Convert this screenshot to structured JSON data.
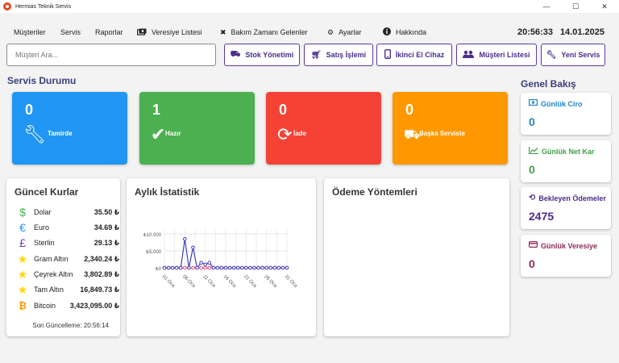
{
  "window": {
    "title": "Hermias Teknik Servis",
    "minimize": "—",
    "maximize": "☐",
    "close": "✕"
  },
  "menu": {
    "items": [
      {
        "label": "Müşteriler",
        "icon": ""
      },
      {
        "label": "Servis",
        "icon": ""
      },
      {
        "label": "Raporlar",
        "icon": ""
      },
      {
        "label": "Veresiye Listesi",
        "icon": "money-icon"
      },
      {
        "label": "Bakım Zamanı Gelenler",
        "icon": "tools-icon"
      },
      {
        "label": "Ayarlar",
        "icon": "gear-icon"
      },
      {
        "label": "Hakkında",
        "icon": "info-icon"
      }
    ],
    "time": "20:56:33",
    "date": "14.01.2025"
  },
  "toolbar": {
    "search_placeholder": "Müşteri Ara...",
    "buttons": [
      {
        "label": "Stok Yönetimi",
        "icon": "stock-icon"
      },
      {
        "label": "Satış İşlemi",
        "icon": "cart-icon"
      },
      {
        "label": "İkinci El Cihaz",
        "icon": "phone-icon"
      },
      {
        "label": "Müşteri Listesi",
        "icon": "users-icon"
      },
      {
        "label": "Yeni Servis",
        "icon": "wrench-icon"
      }
    ]
  },
  "service_status": {
    "title": "Servis Durumu",
    "cards": [
      {
        "value": "0",
        "label": "Tamirde",
        "color": "#2196f3",
        "icon": "wrench-icon"
      },
      {
        "value": "1",
        "label": "Hazır",
        "color": "#4caf50",
        "icon": "check-icon"
      },
      {
        "value": "0",
        "label": "İade",
        "color": "#f44336",
        "icon": "refresh-icon"
      },
      {
        "value": "0",
        "label": "Başka Serviste",
        "color": "#ff9800",
        "icon": "truck-icon"
      }
    ]
  },
  "rates": {
    "title": "Güncel Kurlar",
    "items": [
      {
        "name": "Dolar",
        "value": "35.50 ₺",
        "icon": "dollar-icon",
        "color": "#4caf50"
      },
      {
        "name": "Euro",
        "value": "34.69 ₺",
        "icon": "euro-icon",
        "color": "#2196f3"
      },
      {
        "name": "Sterlin",
        "value": "29.13 ₺",
        "icon": "pound-icon",
        "color": "#673ab7"
      },
      {
        "name": "Gram Altın",
        "value": "2,340.24 ₺",
        "icon": "star-icon",
        "color": "#ffd600"
      },
      {
        "name": "Çeyrek Altın",
        "value": "3,802.89 ₺",
        "icon": "star-icon",
        "color": "#ffd600"
      },
      {
        "name": "Tam Altın",
        "value": "16,849.73 ₺",
        "icon": "star-icon",
        "color": "#ffd600"
      },
      {
        "name": "Bitcoin",
        "value": "3,423,095.00 ₺",
        "icon": "bitcoin-icon",
        "color": "#ff9800"
      }
    ],
    "updated": "Son Güncelleme: 20:56:14"
  },
  "monthly": {
    "title": "Aylık İstatistik"
  },
  "payments": {
    "title": "Ödeme Yöntemleri"
  },
  "overview": {
    "title": "Genel Bakış",
    "cards": [
      {
        "label": "Günlük Ciro",
        "value": "0",
        "color": "#1e88c8",
        "icon": "cash-icon"
      },
      {
        "label": "Günlük Net Kar",
        "value": "0",
        "color": "#43a047",
        "icon": "chart-up-icon"
      },
      {
        "label": "Bekleyen Ödemeler",
        "value": "2475",
        "color": "#4a2d8c",
        "icon": "history-icon"
      },
      {
        "label": "Günlük Veresiye",
        "value": "0",
        "color": "#8e2d5a",
        "icon": "card-icon"
      }
    ]
  },
  "chart_data": {
    "type": "line",
    "title": "Aylık İstatistik",
    "ytick_labels": [
      "₺0",
      "₺5.000",
      "₺10.000"
    ],
    "ylim": [
      0,
      10000
    ],
    "xtick_labels": [
      "01 Oca",
      "06 Oca",
      "11 Oca",
      "16 Oca",
      "21 Oca",
      "26 Oca",
      "31 Oca"
    ],
    "x": [
      1,
      2,
      3,
      4,
      5,
      6,
      7,
      8,
      9,
      10,
      11,
      12,
      13,
      14,
      15,
      16,
      17,
      18,
      19,
      20,
      21,
      22,
      23,
      24,
      25,
      26,
      27,
      28,
      29,
      30,
      31
    ],
    "series": [
      {
        "values": [
          0,
          0,
          0,
          0,
          0,
          8500,
          0,
          6000,
          0,
          1500,
          1000,
          1500,
          0,
          0,
          0,
          0,
          0,
          0,
          0,
          0,
          0,
          0,
          0,
          0,
          0,
          0,
          0,
          0,
          0,
          0,
          0
        ],
        "color": "#3f3fbf"
      },
      {
        "values": [
          0,
          0,
          0,
          0,
          0,
          0,
          0,
          0,
          0,
          0,
          0,
          0,
          0,
          0,
          0,
          0,
          0,
          0,
          0,
          0,
          0,
          0,
          0,
          0,
          0,
          0,
          0,
          0,
          0,
          0,
          0
        ],
        "color": "#e05080"
      }
    ],
    "grid": true
  }
}
